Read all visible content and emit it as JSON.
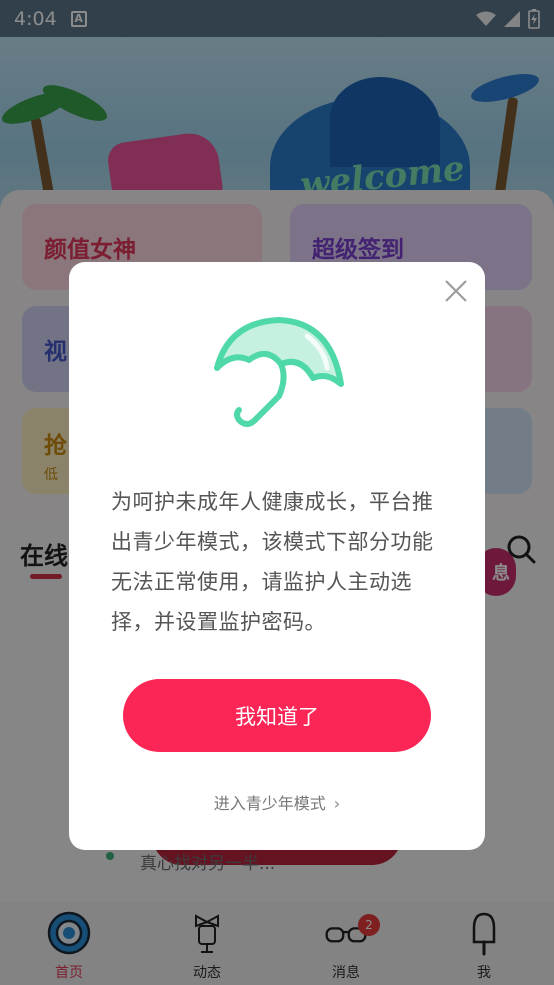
{
  "status_bar": {
    "time": "4:04",
    "notification_icon": "a-icon",
    "wifi_icon": "wifi-icon",
    "signal_icon": "signal-icon",
    "battery_icon": "battery-icon"
  },
  "banner": {
    "text": "welcome"
  },
  "feature_cards": [
    {
      "title": "颜值女神",
      "subtitle": ""
    },
    {
      "title": "超级签到",
      "subtitle": ""
    },
    {
      "title": "视",
      "subtitle": ""
    },
    {
      "title": "抢",
      "subtitle": "低"
    }
  ],
  "section": {
    "title": "在线",
    "pink_float_text": "息"
  },
  "background_item_text": "真心找对另一半...",
  "dialog": {
    "message": "为呵护未成年人健康成长，平台推出青少年模式，该模式下部分功能无法正常使用，请监护人主动选择，并设置监护密码。",
    "primary_button": "我知道了",
    "enter_link": "进入青少年模式",
    "link_chevron": "›",
    "close_icon": "close-icon",
    "illustration": "umbrella-icon",
    "accent_color": "#fc2656",
    "umbrella_color": "#4fd8a8"
  },
  "tabbar": {
    "items": [
      {
        "label": "首页",
        "icon": "home-ring-icon",
        "active": true
      },
      {
        "label": "动态",
        "icon": "bow-trophy-icon",
        "active": false
      },
      {
        "label": "消息",
        "icon": "glasses-icon",
        "active": false,
        "badge": "2"
      },
      {
        "label": "我",
        "icon": "popsicle-icon",
        "active": false
      }
    ]
  }
}
